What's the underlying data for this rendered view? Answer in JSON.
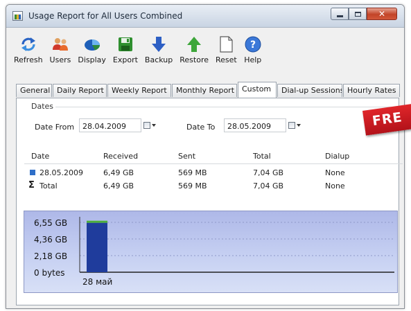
{
  "window": {
    "title": "Usage Report for All Users Combined"
  },
  "toolbar": [
    {
      "id": "refresh",
      "label": "Refresh",
      "icon": "refresh-icon"
    },
    {
      "id": "users",
      "label": "Users",
      "icon": "users-icon"
    },
    {
      "id": "display",
      "label": "Display",
      "icon": "display-icon"
    },
    {
      "id": "export",
      "label": "Export",
      "icon": "save-icon"
    },
    {
      "id": "backup",
      "label": "Backup",
      "icon": "arrow-down-icon"
    },
    {
      "id": "restore",
      "label": "Restore",
      "icon": "arrow-up-icon"
    },
    {
      "id": "reset",
      "label": "Reset",
      "icon": "blank-page-icon"
    },
    {
      "id": "help",
      "label": "Help",
      "icon": "help-icon"
    }
  ],
  "tabs": [
    {
      "label": "General",
      "active": false
    },
    {
      "label": "Daily Report",
      "active": false
    },
    {
      "label": "Weekly Report",
      "active": false
    },
    {
      "label": "Monthly Report",
      "active": false
    },
    {
      "label": "Custom",
      "active": true
    },
    {
      "label": "Dial-up Sessions",
      "active": false
    },
    {
      "label": "Hourly Rates",
      "active": false
    }
  ],
  "dates": {
    "legend": "Dates",
    "from_label": "Date From",
    "from_value": "28.04.2009",
    "to_label": "Date To",
    "to_value": "28.05.2009"
  },
  "table": {
    "columns": [
      "Date",
      "Received",
      "Sent",
      "Total",
      "Dialup"
    ],
    "rows": [
      {
        "date": "28.05.2009",
        "received": "6,49 GB",
        "sent": "569 MB",
        "total": "7,04 GB",
        "dialup": "None",
        "icon": "day-icon"
      },
      {
        "date": "Total",
        "received": "6,49 GB",
        "sent": "569 MB",
        "total": "7,04 GB",
        "dialup": "None",
        "icon": "sigma-icon"
      }
    ]
  },
  "banner": {
    "text": "FRE"
  },
  "chart_data": {
    "type": "bar",
    "categories": [
      "28 май"
    ],
    "values": [
      6.49
    ],
    "sent_values": [
      0.56
    ],
    "yticks": [
      "0 bytes",
      "2,18 GB",
      "4,36 GB",
      "6,55 GB"
    ],
    "ylim": [
      0,
      6.55
    ],
    "colors": {
      "received": "#1f3c9c",
      "sent": "#4caf3a"
    },
    "grid": true
  }
}
